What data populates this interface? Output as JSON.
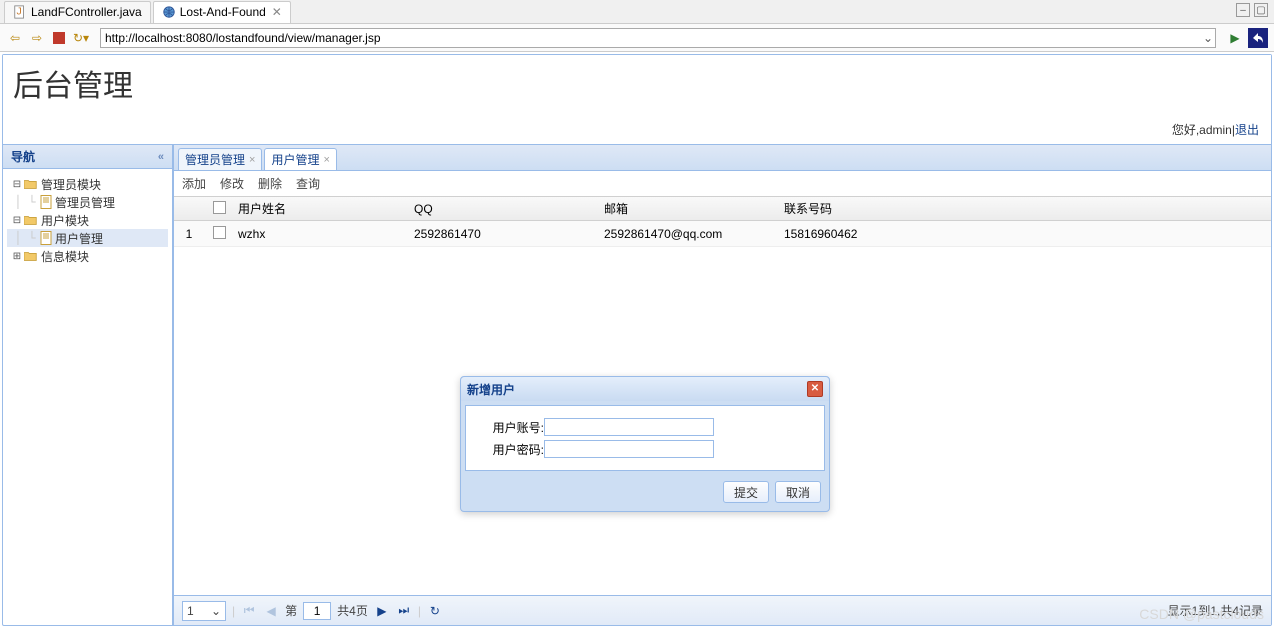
{
  "ide": {
    "tabs": [
      {
        "label": "LandFController.java",
        "icon": "java-file",
        "active": false,
        "closable": false
      },
      {
        "label": "Lost-And-Found",
        "icon": "globe",
        "active": true,
        "closable": true
      }
    ],
    "url": "http://localhost:8080/lostandfound/view/manager.jsp"
  },
  "app": {
    "title": "后台管理",
    "greeting_prefix": "您好,",
    "username": "admin",
    "logout_label": "退出"
  },
  "sidebar": {
    "title": "导航",
    "nodes": [
      {
        "label": "管理员模块",
        "type": "folder",
        "expanded": true
      },
      {
        "label": "管理员管理",
        "type": "doc",
        "indent": 1
      },
      {
        "label": "用户模块",
        "type": "folder",
        "expanded": true
      },
      {
        "label": "用户管理",
        "type": "doc",
        "indent": 1,
        "selected": true
      },
      {
        "label": "信息模块",
        "type": "folder",
        "expanded": false
      }
    ]
  },
  "tabs": [
    {
      "label": "管理员管理",
      "active": false
    },
    {
      "label": "用户管理",
      "active": true
    }
  ],
  "toolbar": {
    "add": "添加",
    "edit": "修改",
    "delete": "删除",
    "query": "查询"
  },
  "grid": {
    "columns": {
      "name": "用户姓名",
      "qq": "QQ",
      "mail": "邮箱",
      "phone": "联系号码"
    },
    "rows": [
      {
        "index": "1",
        "name": "wzhx",
        "qq": "2592861470",
        "mail": "2592861470@qq.com",
        "phone": "15816960462"
      }
    ]
  },
  "pager": {
    "page_size": "1",
    "page_label_prefix": "第",
    "page": "1",
    "total_pages_label": "共4页",
    "info": "显示1到1,共4记录"
  },
  "dialog": {
    "title": "新增用户",
    "field_account": "用户账号:",
    "field_password": "用户密码:",
    "submit": "提交",
    "cancel": "取消"
  },
  "watermark": "CSDN @pastclouds"
}
